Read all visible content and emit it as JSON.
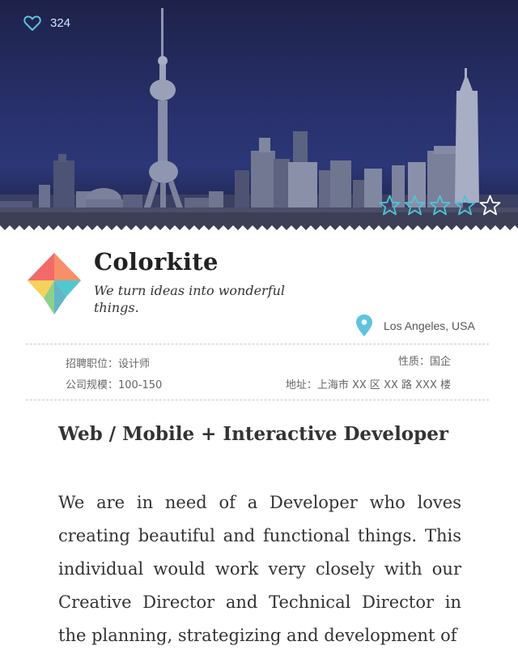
{
  "hero": {
    "likes": "324",
    "rating": 4,
    "rating_max": 5,
    "like_color": "#5ec4dc",
    "star_filled_color": "#4fc2d8",
    "star_empty_color": "#ffffff"
  },
  "company": {
    "name": "Colorkite",
    "tagline": "We turn ideas into wonderful things.",
    "location": "Los Angeles, USA",
    "pin_color": "#5ec4dc"
  },
  "info": {
    "position": "招聘职位：设计师",
    "nature": "性质：国企",
    "size": "公司规模：100-150",
    "address": "地址：上海市 XX 区 XX 路 XXX 楼"
  },
  "job": {
    "title": "Web / Mobile + Interactive Developer",
    "description": "We are in need of a Developer who loves creating beautiful and functional things. This individual would work very closely with our Creative Director and Technical Director in the planning, strategizing and development of"
  }
}
